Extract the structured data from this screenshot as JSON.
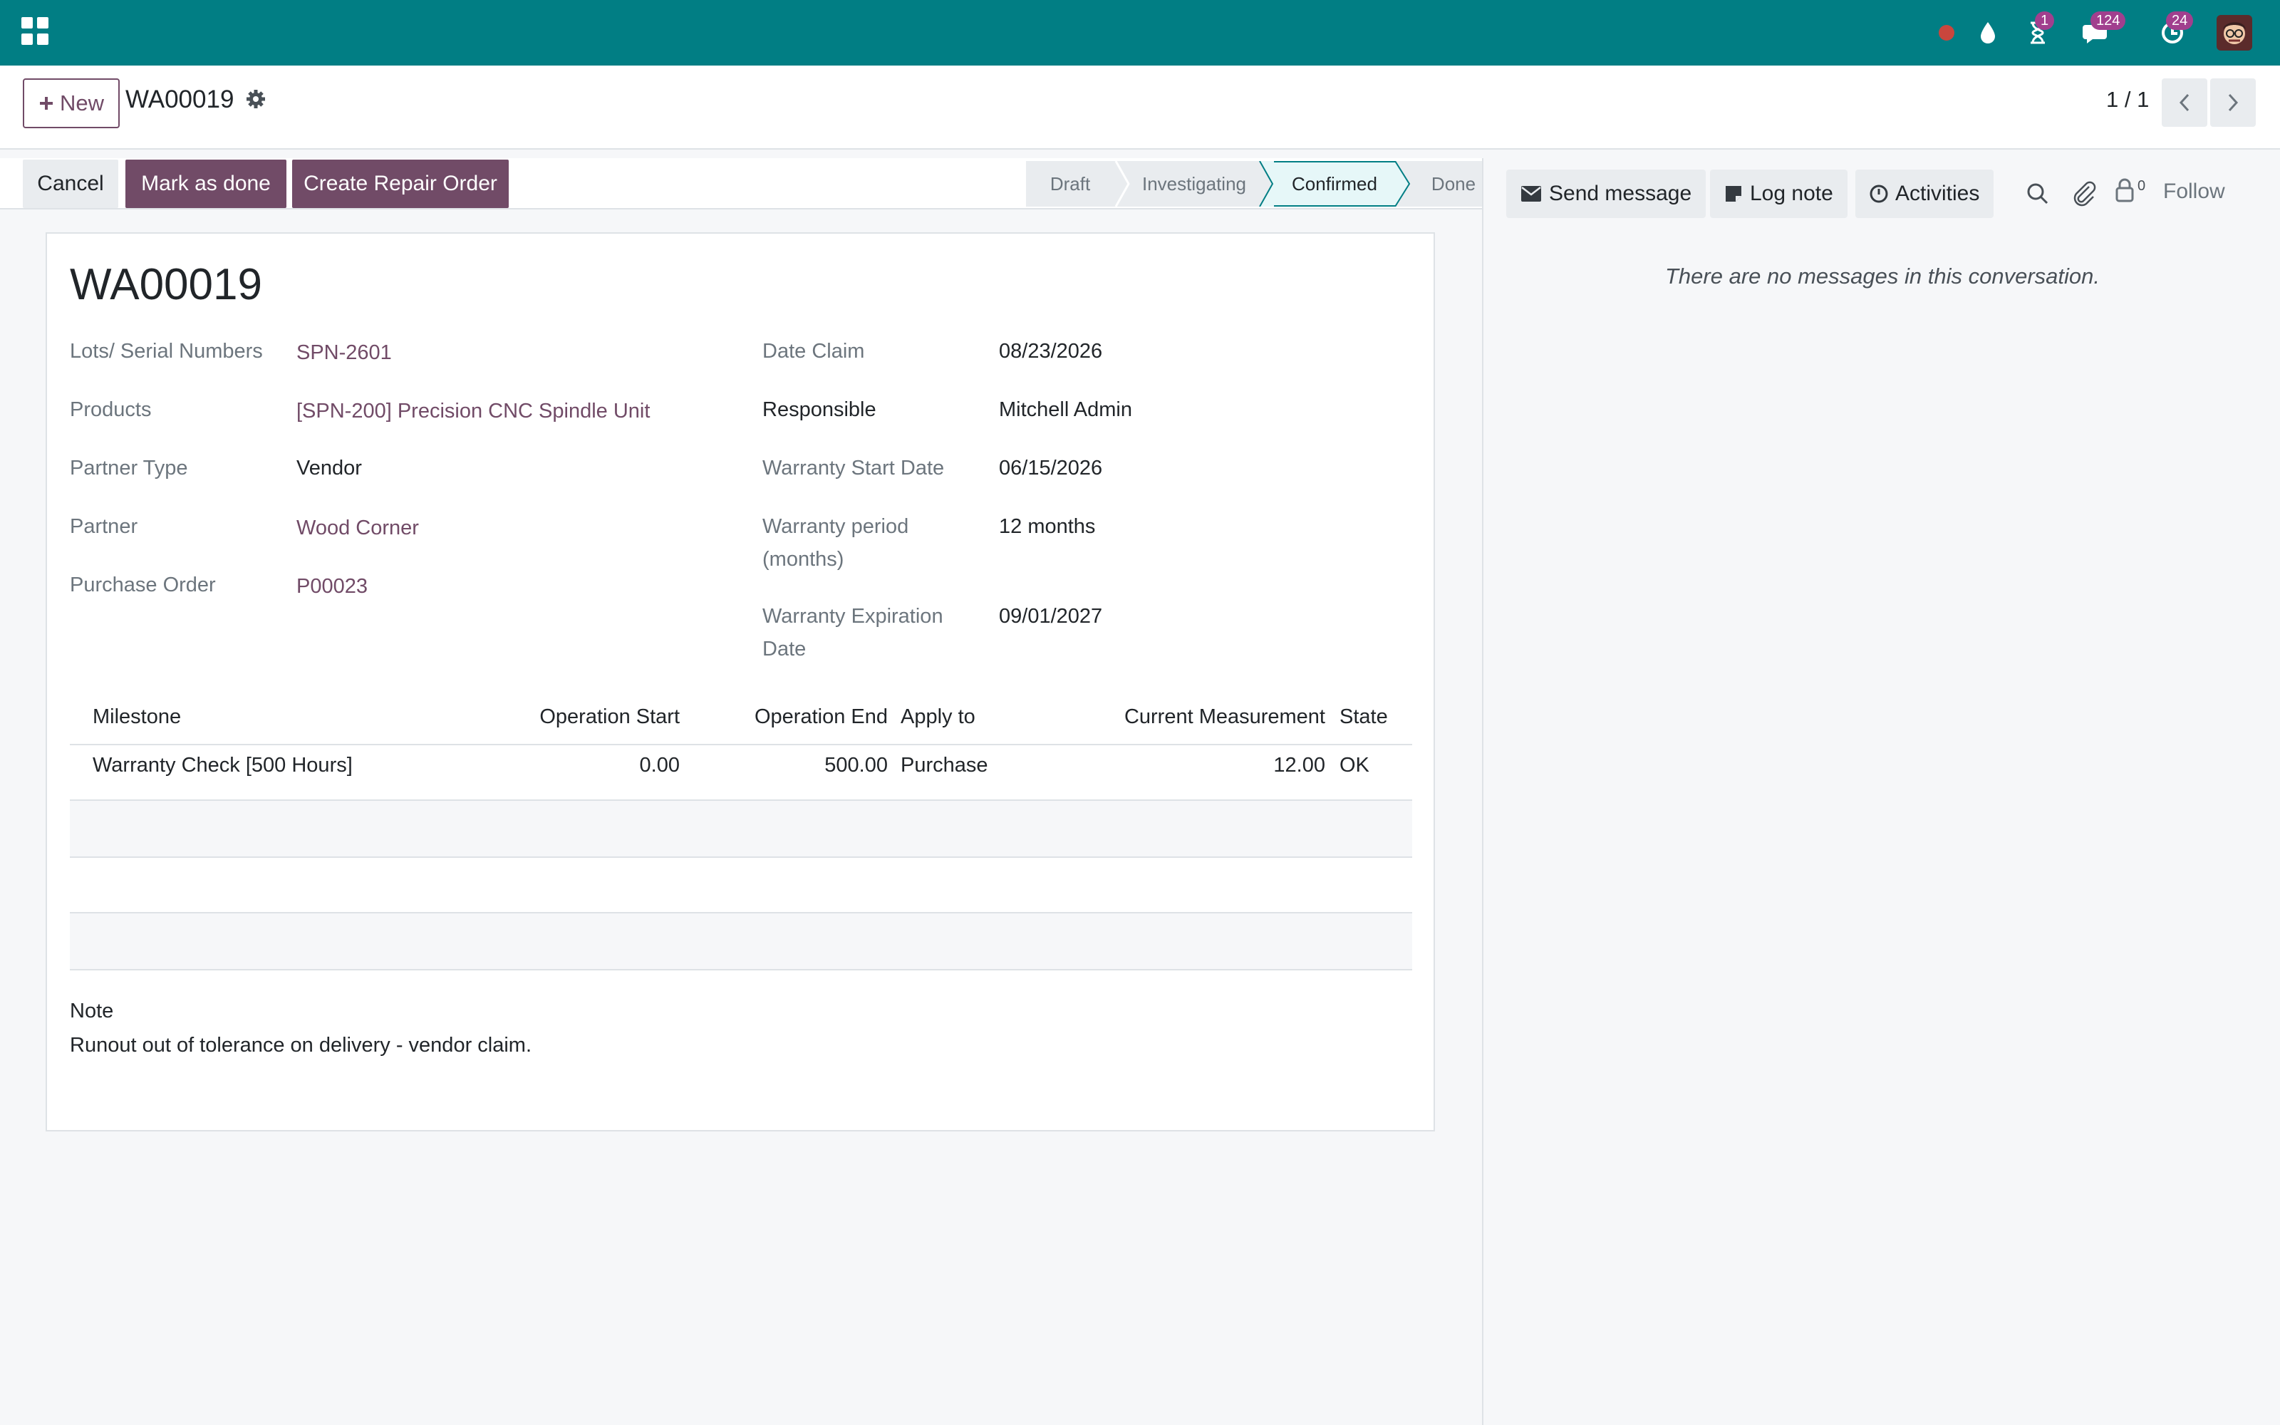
{
  "topbar": {
    "badges": {
      "activities": "1",
      "messages": "124",
      "updates": "24"
    }
  },
  "control": {
    "new_label": "New",
    "record_title": "WA00019",
    "pager": "1 / 1"
  },
  "actions": {
    "cancel": "Cancel",
    "mark_done": "Mark as done",
    "create_repair": "Create Repair Order"
  },
  "stages": [
    "Draft",
    "Investigating",
    "Confirmed",
    "Done"
  ],
  "active_stage": "Confirmed",
  "form": {
    "title": "WA00019",
    "left": [
      {
        "label": "Lots/ Serial Numbers",
        "value": "SPN-2601",
        "link": true
      },
      {
        "label": "Products",
        "value": "[SPN-200] Precision CNC Spindle Unit",
        "link": true
      },
      {
        "label": "Partner Type",
        "value": "Vendor",
        "link": false
      },
      {
        "label": "Partner",
        "value": "Wood Corner",
        "link": true
      },
      {
        "label": "Purchase Order",
        "value": "P00023",
        "link": true
      }
    ],
    "right": {
      "date_claim_label": "Date Claim",
      "date_claim": "08/23/2026",
      "responsible_label": "Responsible",
      "responsible": "Mitchell Admin",
      "start_label": "Warranty Start Date",
      "start": "06/15/2026",
      "period_label_1": "Warranty period",
      "period_label_2": "(months)",
      "period": "12 months",
      "exp_label_1": "Warranty Expiration",
      "exp_label_2": "Date",
      "exp": "09/01/2027"
    },
    "table": {
      "headers": [
        "Milestone",
        "Operation Start",
        "Operation End",
        "Apply to",
        "Current Measurement",
        "State"
      ],
      "rows": [
        {
          "milestone": "Warranty Check [500 Hours]",
          "start": "0.00",
          "end": "500.00",
          "apply": "Purchase",
          "measure": "12.00",
          "state": "OK"
        }
      ]
    },
    "note_label": "Note",
    "note": "Runout out of tolerance on delivery - vendor claim."
  },
  "chatter": {
    "send_message": "Send message",
    "log_note": "Log note",
    "activities": "Activities",
    "followers_count": "0",
    "follow": "Follow",
    "empty": "There are no messages in this conversation."
  },
  "colors": {
    "topbar": "#017e84",
    "primary": "#714b67",
    "active_stage": "#e6f7f8"
  }
}
